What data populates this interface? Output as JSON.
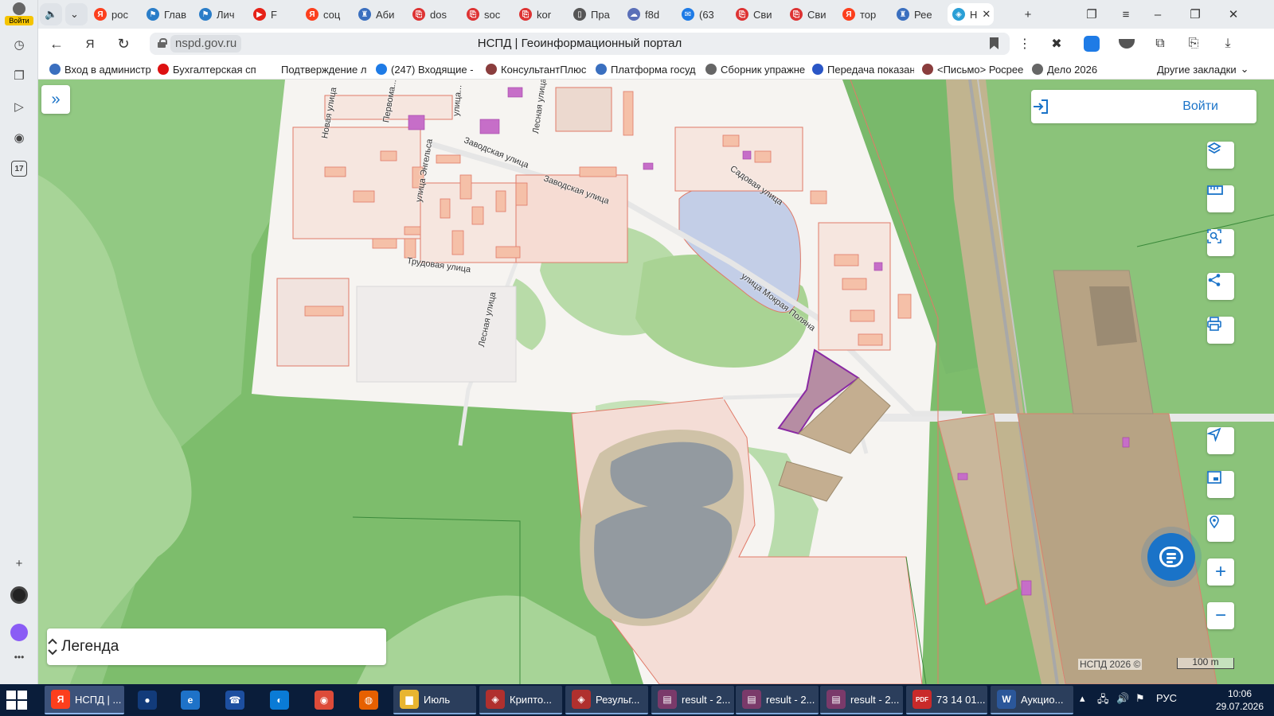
{
  "browser": {
    "login_label": "Войти",
    "tabs": [
      {
        "label": "рос",
        "color": "#fc3f1d",
        "glyph": "Я"
      },
      {
        "label": "Глав",
        "color": "#2a7dc8",
        "glyph": "⚑"
      },
      {
        "label": "Лич",
        "color": "#2a7dc8",
        "glyph": "⚑"
      },
      {
        "label": "F",
        "color": "#e62117",
        "glyph": "▶"
      },
      {
        "label": "соц",
        "color": "#fc3f1d",
        "glyph": "Я"
      },
      {
        "label": "Аби",
        "color": "#3a6fbf",
        "glyph": "♜"
      },
      {
        "label": "dos",
        "color": "#d33",
        "glyph": "⎘"
      },
      {
        "label": "soc",
        "color": "#d33",
        "glyph": "⎘"
      },
      {
        "label": "kor",
        "color": "#d33",
        "glyph": "⎘"
      },
      {
        "label": "Пра",
        "color": "#555",
        "glyph": "▯"
      },
      {
        "label": "f8d",
        "color": "#5a6fb8",
        "glyph": "☁"
      },
      {
        "label": "(63",
        "color": "#1e7be6",
        "glyph": "✉"
      },
      {
        "label": "Сви",
        "color": "#d33",
        "glyph": "⎘"
      },
      {
        "label": "Сви",
        "color": "#d33",
        "glyph": "⎘"
      },
      {
        "label": "тор",
        "color": "#fc3f1d",
        "glyph": "Я"
      },
      {
        "label": "Рее",
        "color": "#3a6fbf",
        "glyph": "♜"
      },
      {
        "label": "Н",
        "color": "#2a9fd6",
        "glyph": "◈"
      }
    ],
    "url_domain": "nspd.gov.ru",
    "page_title": "НСПД | Геоинформационный портал",
    "bookmarks": [
      {
        "label": "Вход в администр",
        "color": "#3a6fbf"
      },
      {
        "label": "Бухгалтерская сп",
        "color": "#d11"
      },
      {
        "label": "Подтверждение л",
        "color": "#ffffff"
      },
      {
        "label": "(247) Входящие -",
        "color": "#1e7be6"
      },
      {
        "label": "КонсультантПлюс",
        "color": "#8a3d3d"
      },
      {
        "label": "Платформа госуд",
        "color": "#3a6fbf"
      },
      {
        "label": "Сборник упражне",
        "color": "#666"
      },
      {
        "label": "Передача показан",
        "color": "#2a56c6"
      },
      {
        "label": "<Письмо> Росрее",
        "color": "#8a3d3d"
      },
      {
        "label": "Дело 2026",
        "color": "#666"
      }
    ],
    "other_bookmarks": "Другие закладки"
  },
  "map": {
    "login_button": "Войти",
    "legend_label": "Легенда",
    "streets": [
      "Новая улица",
      "Первома...",
      "улица...",
      "Лесная улица",
      "Заводская улица",
      "Заводская улица",
      "улица Энгельса",
      "Трудовая улица",
      "Лесная улица",
      "Садовая улица",
      "улица Мокрая Поляна"
    ],
    "copyright": "НСПД 2026 ©",
    "scale_label": "100 m",
    "tools": [
      "layers-icon",
      "ruler-icon",
      "area-search-icon",
      "share-icon",
      "print-icon",
      "locate-icon",
      "minimap-icon",
      "geo-pin-icon",
      "zoom-in-icon",
      "zoom-out-icon"
    ]
  },
  "taskbar": {
    "items": [
      {
        "label": "НСПД | ...",
        "color": "#fc3f1d",
        "glyph": "Я",
        "state": "act"
      },
      {
        "label": "",
        "color": "#123b7a",
        "glyph": "●",
        "state": "pin"
      },
      {
        "label": "",
        "color": "#1e72c8",
        "glyph": "e",
        "state": "pin"
      },
      {
        "label": "",
        "color": "#1d4fa0",
        "glyph": "☎",
        "state": "pin"
      },
      {
        "label": "",
        "color": "#0a7bd6",
        "glyph": "◐",
        "state": "pin"
      },
      {
        "label": "",
        "color": "#dd4b39",
        "glyph": "◉",
        "state": "pin"
      },
      {
        "label": "",
        "color": "#e66000",
        "glyph": "◍",
        "state": "pin"
      },
      {
        "label": "Июль",
        "color": "#e8b530",
        "glyph": "▆",
        "state": "app"
      },
      {
        "label": "Крипто...",
        "color": "#b0302e",
        "glyph": "◈",
        "state": "app"
      },
      {
        "label": "Резульг...",
        "color": "#b0302e",
        "glyph": "◈",
        "state": "app"
      },
      {
        "label": "result - 2...",
        "color": "#7a3a6a",
        "glyph": "▤",
        "state": "app"
      },
      {
        "label": "result - 2...",
        "color": "#7a3a6a",
        "glyph": "▤",
        "state": "app"
      },
      {
        "label": "result - 2...",
        "color": "#7a3a6a",
        "glyph": "▤",
        "state": "app"
      },
      {
        "label": "73 14 01...",
        "color": "#c92a2a",
        "glyph": "PDF",
        "state": "app"
      },
      {
        "label": "Аукцио...",
        "color": "#2b579a",
        "glyph": "W",
        "state": "app"
      }
    ],
    "lang": "РУС",
    "time": "10:06",
    "date": "29.07.2026"
  }
}
